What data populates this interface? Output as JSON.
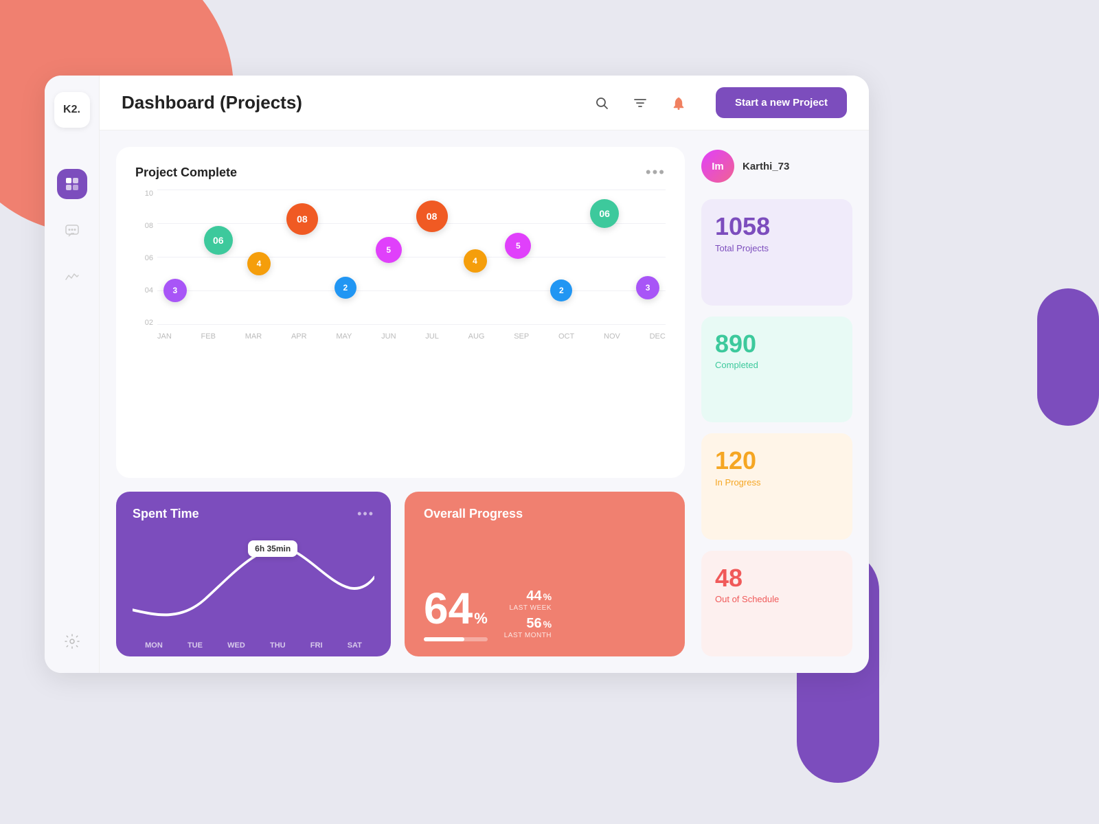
{
  "background": {
    "desc": "decorative background shapes"
  },
  "sidebar": {
    "logo": "K2.",
    "nav_items": [
      {
        "id": "dashboard",
        "icon": "⊞",
        "active": true
      },
      {
        "id": "chat",
        "icon": "💬",
        "active": false
      },
      {
        "id": "activity",
        "icon": "📊",
        "active": false
      }
    ],
    "settings_icon": "⚙"
  },
  "header": {
    "title": "Dashboard (Projects)",
    "search_icon": "search",
    "filter_icon": "filter",
    "notification_icon": "bell",
    "new_project_btn": "Start a new Project"
  },
  "chart": {
    "title": "Project Complete",
    "dots_menu": "•••",
    "y_axis": [
      "10",
      "08",
      "06",
      "04",
      "02"
    ],
    "x_axis": [
      "JAN",
      "FEB",
      "MAR",
      "APR",
      "MAY",
      "JUN",
      "JUL",
      "AUG",
      "SEP",
      "OCT",
      "NOV",
      "DEC"
    ],
    "bubbles": [
      {
        "month": "JAN",
        "x_pct": 3.5,
        "y_pct": 75,
        "value": "3",
        "color": "#a855f7",
        "size": 34
      },
      {
        "month": "FEB",
        "x_pct": 12,
        "y_pct": 38,
        "value": "06",
        "color": "#3dc99c",
        "size": 42
      },
      {
        "month": "MAR",
        "x_pct": 20,
        "y_pct": 55,
        "value": "4",
        "color": "#f59e0b",
        "size": 34
      },
      {
        "month": "APR",
        "x_pct": 28.5,
        "y_pct": 22,
        "value": "08",
        "color": "#f05a23",
        "size": 46
      },
      {
        "month": "MAY",
        "x_pct": 37,
        "y_pct": 73,
        "value": "2",
        "color": "#2196f3",
        "size": 32
      },
      {
        "month": "JUN",
        "x_pct": 45.5,
        "y_pct": 45,
        "value": "5",
        "color": "#e040fb",
        "size": 38
      },
      {
        "month": "JUL",
        "x_pct": 54,
        "y_pct": 20,
        "value": "08",
        "color": "#f05a23",
        "size": 46
      },
      {
        "month": "AUG",
        "x_pct": 62.5,
        "y_pct": 53,
        "value": "4",
        "color": "#f59e0b",
        "size": 34
      },
      {
        "month": "SEP",
        "x_pct": 71,
        "y_pct": 42,
        "value": "5",
        "color": "#e040fb",
        "size": 38
      },
      {
        "month": "OCT",
        "x_pct": 79.5,
        "y_pct": 75,
        "value": "2",
        "color": "#2196f3",
        "size": 32
      },
      {
        "month": "NOV",
        "x_pct": 88,
        "y_pct": 18,
        "value": "06",
        "color": "#3dc99c",
        "size": 42
      },
      {
        "month": "DEC",
        "x_pct": 96.5,
        "y_pct": 73,
        "value": "3",
        "color": "#a855f7",
        "size": 34
      }
    ]
  },
  "spent_time": {
    "title": "Spent Time",
    "dots_menu": "•••",
    "tooltip": "6h 35min",
    "x_axis": [
      "MON",
      "TUE",
      "WED",
      "THU",
      "FRI",
      "SAT"
    ]
  },
  "overall_progress": {
    "title": "Overall Progress",
    "percent": "64",
    "percent_symbol": "%",
    "bar_fill_pct": 64,
    "last_week_value": "44",
    "last_week_label": "LAST WEEK",
    "last_week_unit": "%",
    "last_month_value": "56",
    "last_month_label": "LAST MONTH",
    "last_month_unit": "%"
  },
  "user": {
    "avatar_initials": "Im",
    "name": "Karthi_73"
  },
  "stats": [
    {
      "number": "1058",
      "label": "Total Projects",
      "bg": "purple-bg",
      "num_class": "purple-num",
      "lbl_class": "purple-lbl"
    },
    {
      "number": "890",
      "label": "Completed",
      "bg": "teal-bg",
      "num_class": "teal-num",
      "lbl_class": "teal-lbl"
    },
    {
      "number": "120",
      "label": "In Progress",
      "bg": "orange-bg",
      "num_class": "orange-num",
      "lbl_class": "orange-lbl"
    },
    {
      "number": "48",
      "label": "Out of Schedule",
      "bg": "red-bg",
      "num_class": "red-num",
      "lbl_class": "red-lbl"
    }
  ]
}
